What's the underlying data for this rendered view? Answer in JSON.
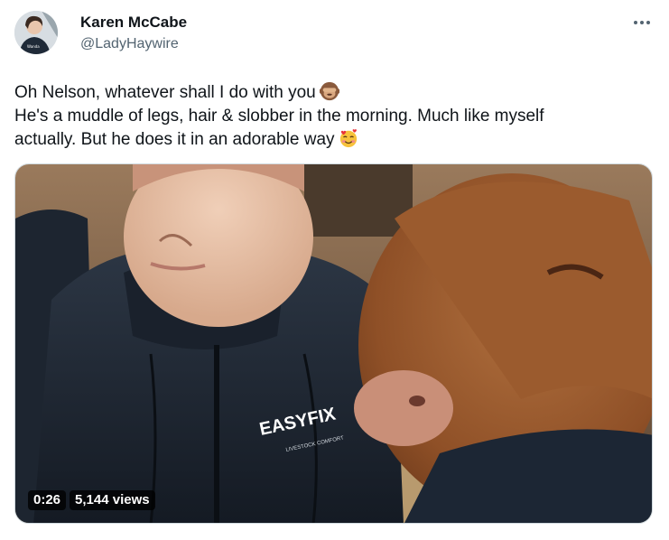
{
  "author": {
    "display_name": "Karen McCabe",
    "handle": "@LadyHaywire"
  },
  "tweet": {
    "line1": "Oh Nelson, whatever shall I do with you",
    "line1_emoji": "see-no-evil-monkey-emoji",
    "line2": "He's a muddle of legs, hair & slobber in the morning. Much like myself",
    "line3": "actually. But he does it in an adorable way",
    "line3_emoji": "smiling-face-with-hearts-emoji"
  },
  "media": {
    "type": "video",
    "duration": "0:26",
    "views": "5,144 views",
    "jacket_logo": "EASYFIX",
    "jacket_tagline": "LIVESTOCK COMFORT"
  },
  "colors": {
    "text": "#0f1419",
    "secondary": "#536471",
    "border": "#cfd9de"
  }
}
